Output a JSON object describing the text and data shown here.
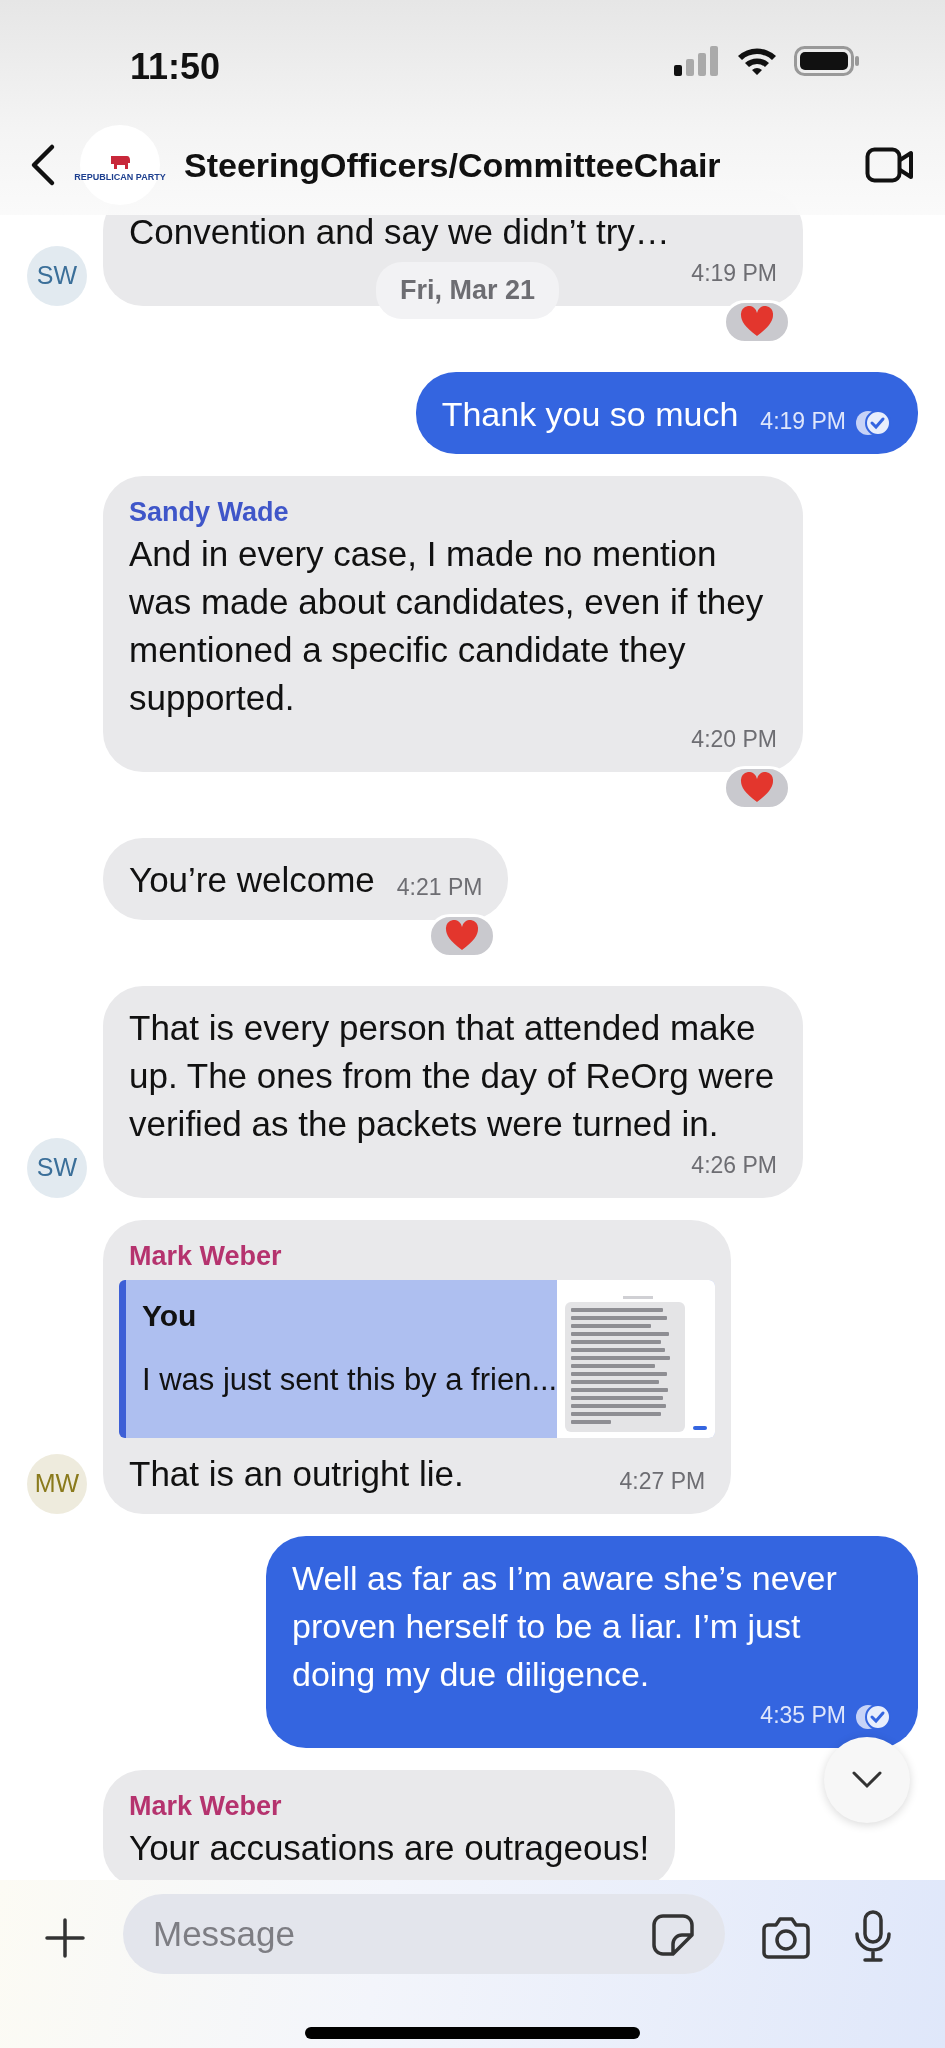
{
  "status_bar": {
    "time": "11:50"
  },
  "header": {
    "logo_text": "REPUBLICAN PARTY",
    "title": "SteeringOfficers/CommitteeChair"
  },
  "date_separator": "Fri, Mar 21",
  "messages": [
    {
      "kind": "incoming",
      "text": "Convention and say we didn’t try…",
      "time": "4:19 PM",
      "reacted": true,
      "avatar": {
        "initials": "SW",
        "color": "#3b6f99"
      }
    },
    {
      "kind": "outgoing",
      "text": "Thank you so much",
      "time": "4:19 PM",
      "reacted": false
    },
    {
      "kind": "incoming",
      "sender": {
        "name": "Sandy Wade",
        "color": "#3f56c9"
      },
      "text": "And in every case, I made no mention was made about candidates, even if they mentioned a specific candidate they supported.",
      "time": "4:20 PM",
      "reacted": true
    },
    {
      "kind": "incoming",
      "text": "You’re welcome",
      "time": "4:21 PM",
      "reacted": true
    },
    {
      "kind": "incoming",
      "text": "That is every person that attended make up.  The ones from the day of ReOrg were verified as the packets were turned in.",
      "time": "4:26 PM",
      "reacted": false,
      "avatar": {
        "initials": "SW",
        "color": "#3b6f99"
      }
    },
    {
      "kind": "incoming",
      "sender": {
        "name": "Mark Weber",
        "color": "#b5336e"
      },
      "reply": {
        "author": "You",
        "text": "I was just sent this by a frien..."
      },
      "text": "That is an outright lie.",
      "time": "4:27 PM",
      "reacted": false,
      "avatar": {
        "initials": "MW",
        "color": "#8a7a1c"
      }
    },
    {
      "kind": "outgoing",
      "text": "Well as far as I’m aware she’s never proven herself to be a liar. I’m just doing my due diligence.",
      "time": "4:35 PM",
      "reacted": false
    },
    {
      "kind": "incoming",
      "sender": {
        "name": "Mark Weber",
        "color": "#b5336e"
      },
      "text": "Your accusations are outrageous!",
      "reacted": false
    }
  ],
  "composer": {
    "placeholder": "Message"
  }
}
